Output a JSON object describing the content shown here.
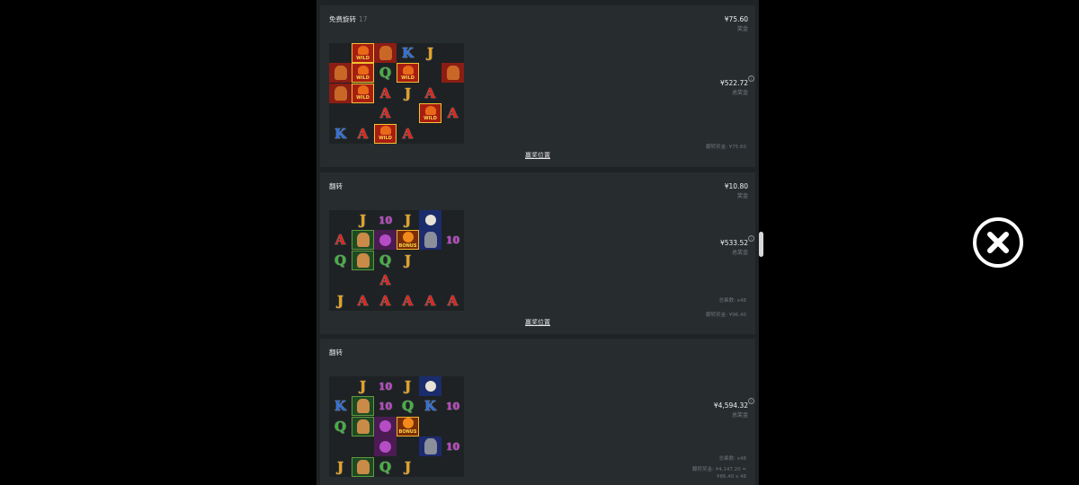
{
  "rounds": [
    {
      "title": "免费旋转",
      "count": "17",
      "prize_value": "¥75.60",
      "prize_label": "奖金",
      "total_value": "¥522.72",
      "total_label": "总奖金",
      "notes": [
        "翻转奖金: ¥75.60"
      ],
      "link": "赢奖位置",
      "grid": [
        [
          "",
          "wild",
          "animal",
          "K",
          "J",
          ""
        ],
        [
          "animal",
          "wild",
          "Q",
          "wild",
          "",
          "animal"
        ],
        [
          "animal",
          "wild",
          "A",
          "J",
          "A",
          ""
        ],
        [
          "",
          "",
          "A",
          "",
          "wild",
          "A"
        ],
        [
          "K",
          "A",
          "wild",
          "A",
          "",
          ""
        ]
      ]
    },
    {
      "title": "翻转",
      "count": "",
      "prize_value": "¥10.80",
      "prize_label": "奖金",
      "total_value": "¥533.52",
      "total_label": "总奖金",
      "notes": [
        "总乘数: x48",
        "翻转奖金: ¥96.40"
      ],
      "link": "赢奖位置",
      "grid": [
        [
          "",
          "J",
          "10",
          "J",
          "eagle",
          ""
        ],
        [
          "A",
          "cougar",
          "purple",
          "bonus",
          "wolf",
          "10"
        ],
        [
          "Q",
          "cougar",
          "Q",
          "J",
          "",
          ""
        ],
        [
          "",
          "",
          "A",
          "",
          "",
          ""
        ],
        [
          "J",
          "A",
          "A",
          "A",
          "A",
          "A"
        ]
      ]
    },
    {
      "title": "翻转",
      "count": "",
      "prize_value": "",
      "prize_label": "",
      "total_value": "¥4,594.32",
      "total_label": "总奖金",
      "notes": [
        "总乘数: x48",
        "翻转奖金: ¥4,147.20 =",
        "¥86.40 x 48"
      ],
      "link": "",
      "grid": [
        [
          "",
          "J",
          "10",
          "J",
          "eagle",
          ""
        ],
        [
          "K",
          "cougar",
          "10",
          "Q",
          "K",
          "10"
        ],
        [
          "Q",
          "cougar",
          "purple",
          "bonus",
          "",
          ""
        ],
        [
          "",
          "",
          "purple",
          "",
          "wolf",
          "10"
        ],
        [
          "J",
          "cougar",
          "Q",
          "J",
          "",
          ""
        ]
      ]
    }
  ],
  "symbol_labels": {
    "wild": "WILD",
    "bonus": "BONUS"
  },
  "close_icon": "close-circle-icon",
  "info_icon": "info-icon"
}
